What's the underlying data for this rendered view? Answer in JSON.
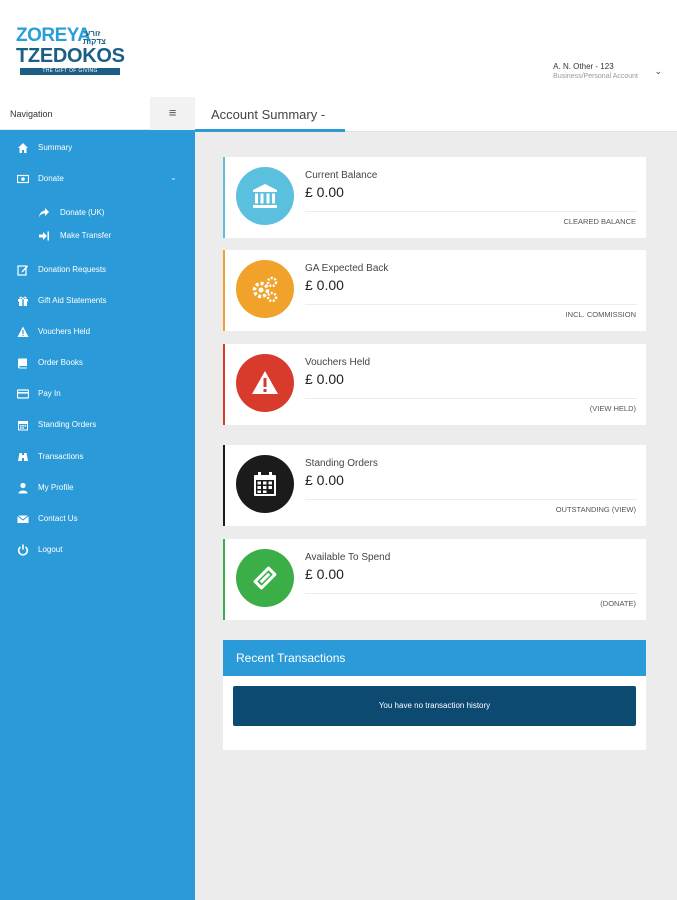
{
  "logo": {
    "line1": "ZOREYA",
    "hebrew": "זורעי צדקות",
    "line2": "TZEDOKOS",
    "tagline": "THE GIFT OF GIVING"
  },
  "user": {
    "name": "A. N. Other - 123",
    "role": "Business/Personal Account"
  },
  "nav": {
    "label": "Navigation",
    "items": [
      {
        "label": "Summary",
        "icon": "home-icon"
      },
      {
        "label": "Donate",
        "icon": "money-icon"
      },
      {
        "label": "Donate (UK)",
        "icon": "share-icon"
      },
      {
        "label": "Make Transfer",
        "icon": "transfer-icon"
      },
      {
        "label": "Donation Requests",
        "icon": "edit-icon"
      },
      {
        "label": "Gift Aid Statements",
        "icon": "gift-icon"
      },
      {
        "label": "Vouchers Held",
        "icon": "warning-icon"
      },
      {
        "label": "Order Books",
        "icon": "book-icon"
      },
      {
        "label": "Pay In",
        "icon": "card-icon"
      },
      {
        "label": "Standing Orders",
        "icon": "calendar-icon"
      },
      {
        "label": "Transactions",
        "icon": "binoculars-icon"
      },
      {
        "label": "My Profile",
        "icon": "user-icon"
      },
      {
        "label": "Contact Us",
        "icon": "envelope-icon"
      },
      {
        "label": "Logout",
        "icon": "power-icon"
      }
    ]
  },
  "page": {
    "title": "Account Summary -"
  },
  "cards": [
    {
      "title": "Current Balance",
      "amount": "£ 0.00",
      "note": "CLEARED BALANCE",
      "color": "#5bc0de",
      "icon": "bank-icon"
    },
    {
      "title": "GA Expected Back",
      "amount": "£ 0.00",
      "note": "INCL. COMMISSION",
      "color": "#f0a22b",
      "icon": "cogs-icon"
    },
    {
      "title": "Vouchers Held",
      "amount": "£ 0.00",
      "note": "(VIEW HELD)",
      "color": "#d83a2c",
      "icon": "warning-icon"
    },
    {
      "title": "Standing Orders",
      "amount": "£ 0.00",
      "note": "OUTSTANDING (VIEW)",
      "color": "#1b1b1b",
      "icon": "calendar-icon"
    },
    {
      "title": "Available To Spend",
      "amount": "£ 0.00",
      "note": "(DONATE)",
      "color": "#3cae48",
      "icon": "ticket-icon"
    }
  ],
  "recent": {
    "title": "Recent Transactions",
    "empty": "You have no transaction history"
  },
  "colors": {
    "accent": "#2b9ad8",
    "dark": "#0c4a72"
  }
}
